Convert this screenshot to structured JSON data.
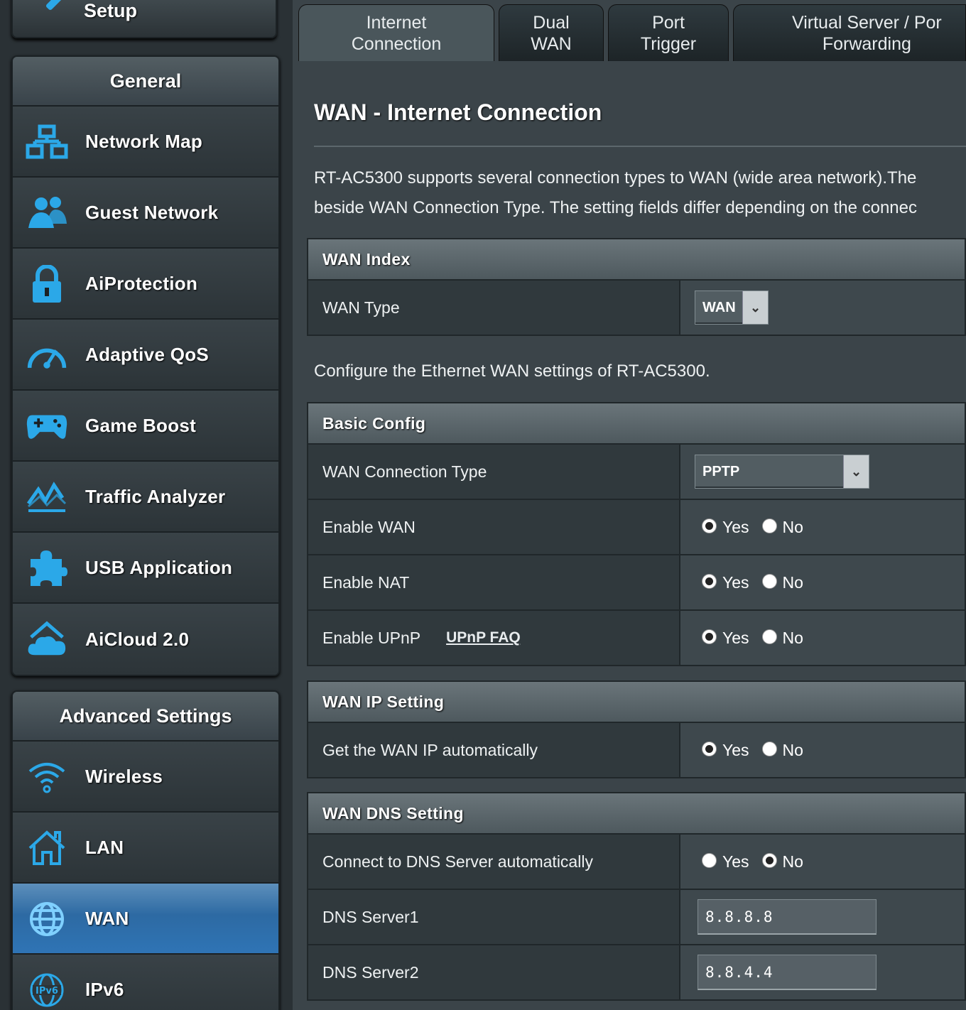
{
  "sidebar": {
    "setup_label": "Setup",
    "general_title": "General",
    "general_items": [
      {
        "label": "Network Map",
        "icon": "network-map-icon"
      },
      {
        "label": "Guest Network",
        "icon": "guest-network-icon"
      },
      {
        "label": "AiProtection",
        "icon": "lock-icon"
      },
      {
        "label": "Adaptive QoS",
        "icon": "speedometer-icon"
      },
      {
        "label": "Game Boost",
        "icon": "gamepad-icon"
      },
      {
        "label": "Traffic Analyzer",
        "icon": "chart-icon"
      },
      {
        "label": "USB Application",
        "icon": "puzzle-icon"
      },
      {
        "label": "AiCloud 2.0",
        "icon": "cloud-home-icon"
      }
    ],
    "advanced_title": "Advanced Settings",
    "advanced_items": [
      {
        "label": "Wireless",
        "icon": "wifi-icon"
      },
      {
        "label": "LAN",
        "icon": "home-icon"
      },
      {
        "label": "WAN",
        "icon": "globe-icon",
        "active": true
      },
      {
        "label": "IPv6",
        "icon": "ipv6-globe-icon"
      }
    ]
  },
  "tabs": [
    {
      "line1": "Internet",
      "line2": "Connection",
      "active": true
    },
    {
      "line1": "Dual",
      "line2": "WAN"
    },
    {
      "line1": "Port",
      "line2": "Trigger"
    },
    {
      "line1": "Virtual Server / Por",
      "line2": "Forwarding"
    }
  ],
  "main": {
    "title": "WAN - Internet Connection",
    "desc_line1": "RT-AC5300 supports several connection types to WAN (wide area network).The",
    "desc_line2": "beside WAN Connection Type. The setting fields differ depending on the connec",
    "configure_text": "Configure the Ethernet WAN settings of RT-AC5300."
  },
  "wan_index": {
    "header": "WAN Index",
    "wan_type_label": "WAN Type",
    "wan_type_value": "WAN"
  },
  "basic_config": {
    "header": "Basic Config",
    "conn_type_label": "WAN Connection Type",
    "conn_type_value": "PPTP",
    "enable_wan_label": "Enable WAN",
    "enable_nat_label": "Enable NAT",
    "enable_upnp_label": "Enable UPnP",
    "upnp_faq_link": "UPnP  FAQ",
    "enable_wan": "Yes",
    "enable_nat": "Yes",
    "enable_upnp": "Yes"
  },
  "wan_ip": {
    "header": "WAN IP Setting",
    "auto_ip_label": "Get the WAN IP automatically",
    "auto_ip": "Yes"
  },
  "wan_dns": {
    "header": "WAN DNS Setting",
    "auto_dns_label": "Connect to DNS Server automatically",
    "auto_dns": "No",
    "dns1_label": "DNS Server1",
    "dns1_value": "8.8.8.8",
    "dns2_label": "DNS Server2",
    "dns2_value": "8.8.4.4"
  },
  "radio_labels": {
    "yes": "Yes",
    "no": "No"
  },
  "colors": {
    "accent": "#2ba8e8",
    "active_menu": "#2f74b5",
    "background": "#3b4449"
  }
}
